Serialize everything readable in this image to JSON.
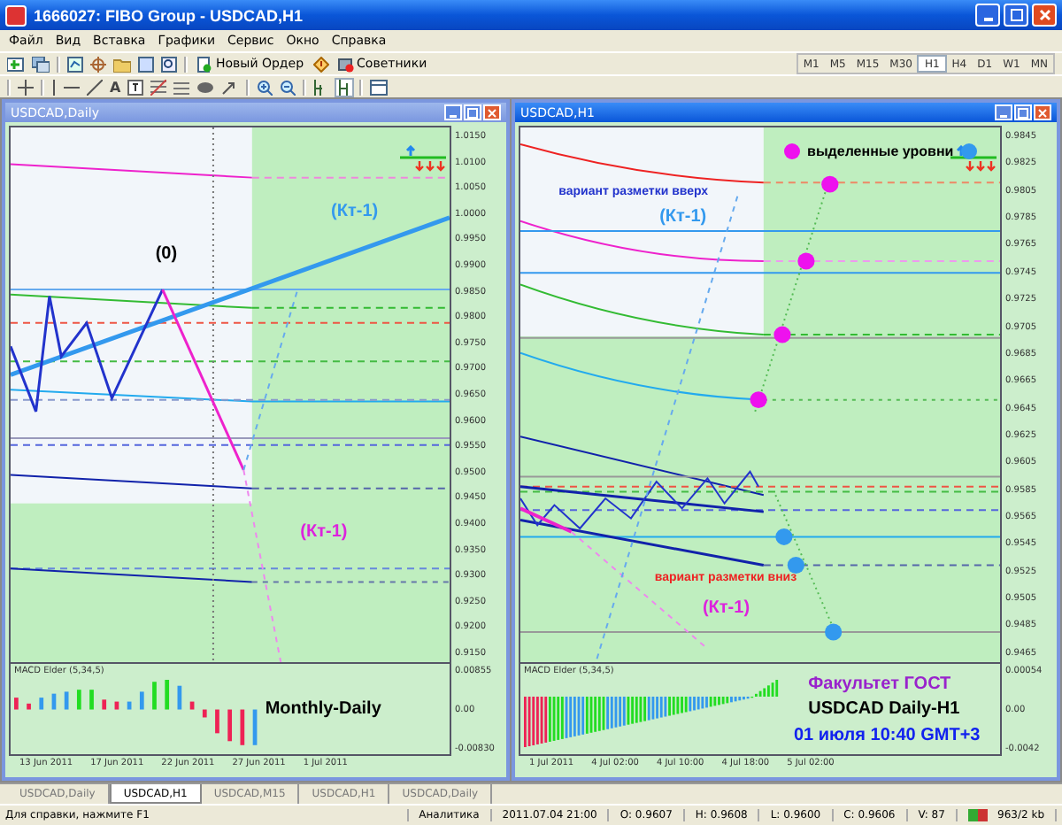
{
  "window": {
    "title": "1666027: FIBO Group - USDCAD,H1"
  },
  "menu": [
    "Файл",
    "Вид",
    "Вставка",
    "Графики",
    "Сервис",
    "Окно",
    "Справка"
  ],
  "toolbar": {
    "buttons": [
      "Новый Ордер",
      "Советники"
    ],
    "text_tool": "A"
  },
  "timeframes": [
    {
      "label": "M1",
      "selected": false
    },
    {
      "label": "M5",
      "selected": false
    },
    {
      "label": "M15",
      "selected": false
    },
    {
      "label": "M30",
      "selected": false
    },
    {
      "label": "H1",
      "selected": true
    },
    {
      "label": "H4",
      "selected": false
    },
    {
      "label": "D1",
      "selected": false
    },
    {
      "label": "W1",
      "selected": false
    },
    {
      "label": "MN",
      "selected": false
    }
  ],
  "charts": [
    {
      "title": "USDCAD,Daily",
      "active": false,
      "price_axis": [
        "1.0150",
        "1.0100",
        "1.0050",
        "1.0000",
        "0.9950",
        "0.9900",
        "0.9850",
        "0.9800",
        "0.9750",
        "0.9700",
        "0.9650",
        "0.9600",
        "0.9550",
        "0.9500",
        "0.9450",
        "0.9400",
        "0.9350",
        "0.9300",
        "0.9250",
        "0.9200",
        "0.9150"
      ],
      "annotations": [
        {
          "kind": "label",
          "text": "(0)",
          "color": "#000000"
        },
        {
          "kind": "label",
          "text": "(Кт-1)",
          "color": "#3399ee"
        },
        {
          "kind": "label",
          "text": "(Кт-1)",
          "color": "#dd22dd"
        }
      ],
      "indicator": {
        "name": "MACD Elder (5,34,5)",
        "axis": [
          "0.00855",
          "0.00",
          "-0.00830"
        ],
        "captions": [
          {
            "text": "Monthly-Daily",
            "color": "#000000"
          }
        ]
      },
      "time_axis": [
        "13 Jun 2011",
        "17 Jun 2011",
        "22 Jun 2011",
        "27 Jun 2011",
        "1 Jul 2011"
      ]
    },
    {
      "title": "USDCAD,H1",
      "active": true,
      "price_axis": [
        "0.9845",
        "0.9825",
        "0.9805",
        "0.9785",
        "0.9765",
        "0.9745",
        "0.9725",
        "0.9705",
        "0.9685",
        "0.9665",
        "0.9645",
        "0.9625",
        "0.9605",
        "0.9585",
        "0.9565",
        "0.9545",
        "0.9525",
        "0.9505",
        "0.9485",
        "0.9465"
      ],
      "legend": "выделенные уровни",
      "annotations": [
        {
          "kind": "note",
          "text": "вариант разметки вверх",
          "color": "#2233cc"
        },
        {
          "kind": "label",
          "text": "(Кт-1)",
          "color": "#3399ee"
        },
        {
          "kind": "note",
          "text": "вариант разметки вниз",
          "color": "#ee2222"
        },
        {
          "kind": "label",
          "text": "(Кт-1)",
          "color": "#dd22dd"
        }
      ],
      "indicator": {
        "name": "MACD Elder (5,34,5)",
        "axis": [
          "0.00054",
          "0.00",
          "-0.0042"
        ],
        "captions": [
          {
            "text": "Факультет ГОСТ",
            "color": "#9922cc"
          },
          {
            "text": "USDCAD Daily-H1",
            "color": "#000000"
          },
          {
            "text": "01 июля 10:40 GMT+3",
            "color": "#1122ee"
          }
        ]
      },
      "time_axis": [
        "1 Jul 2011",
        "4 Jul 02:00",
        "4 Jul 10:00",
        "4 Jul 18:00",
        "5 Jul 02:00"
      ]
    }
  ],
  "tabs": [
    {
      "label": "USDCAD,Daily",
      "selected": false
    },
    {
      "label": "USDCAD,H1",
      "selected": true
    },
    {
      "label": "USDCAD,M15",
      "selected": false
    },
    {
      "label": "USDCAD,H1",
      "selected": false
    },
    {
      "label": "USDCAD,Daily",
      "selected": false
    }
  ],
  "status_bar": {
    "help": "Для справки, нажмите F1",
    "profile": "Аналитика",
    "fields": [
      "2011.07.04 21:00",
      "O: 0.9607",
      "H: 0.9608",
      "L: 0.9600",
      "C: 0.9606",
      "V: 87"
    ],
    "traffic": "963/2 kb"
  }
}
